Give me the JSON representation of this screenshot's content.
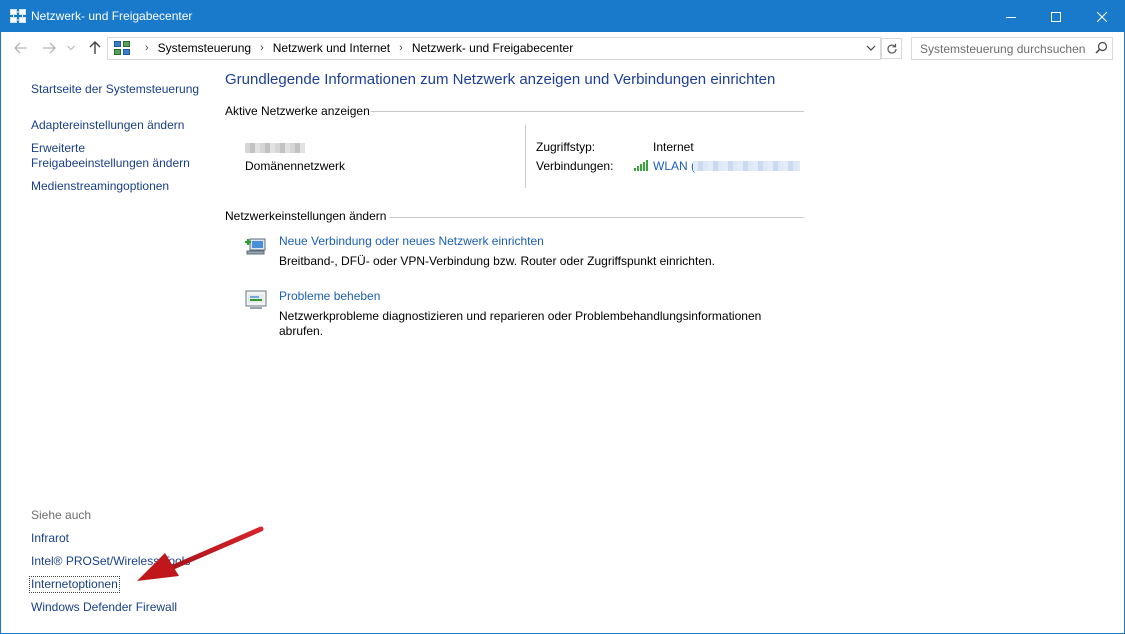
{
  "window": {
    "title": "Netzwerk- und Freigabecenter",
    "accent_color": "#1979ca"
  },
  "addressbar": {
    "breadcrumbs": [
      "Systemsteuerung",
      "Netzwerk und Internet",
      "Netzwerk- und Freigabecenter"
    ],
    "search_placeholder": "Systemsteuerung durchsuchen"
  },
  "leftnav": {
    "items": [
      "Startseite der Systemsteuerung",
      "Adaptereinstellungen ändern",
      "Erweiterte Freigabeeinstellungen ändern",
      "Medienstreamingoptionen"
    ]
  },
  "seealso": {
    "label": "Siehe auch",
    "items": [
      "Infrarot",
      "Intel® PROSet/Wireless Tools",
      "Internetoptionen",
      "Windows Defender Firewall"
    ]
  },
  "main": {
    "heading": "Grundlegende Informationen zum Netzwerk anzeigen und Verbindungen einrichten",
    "active_networks_title": "Aktive Netzwerke anzeigen",
    "network_type": "Domänennetzwerk",
    "access_type_label": "Zugriffstyp:",
    "access_type_value": "Internet",
    "connections_label": "Verbindungen:",
    "connection_name": "WLAN (",
    "settings_title": "Netzwerkeinstellungen ändern",
    "tasks": [
      {
        "title": "Neue Verbindung oder neues Netzwerk einrichten",
        "description": "Breitband-, DFÜ- oder VPN-Verbindung bzw. Router oder Zugriffspunkt einrichten.",
        "icon": "new-connection-icon"
      },
      {
        "title": "Probleme beheben",
        "description": "Netzwerkprobleme diagnostizieren und reparieren oder Problembehandlungsinformationen abrufen.",
        "icon": "troubleshoot-icon"
      }
    ]
  },
  "annotation": {
    "arrow_color": "#c0171c"
  }
}
